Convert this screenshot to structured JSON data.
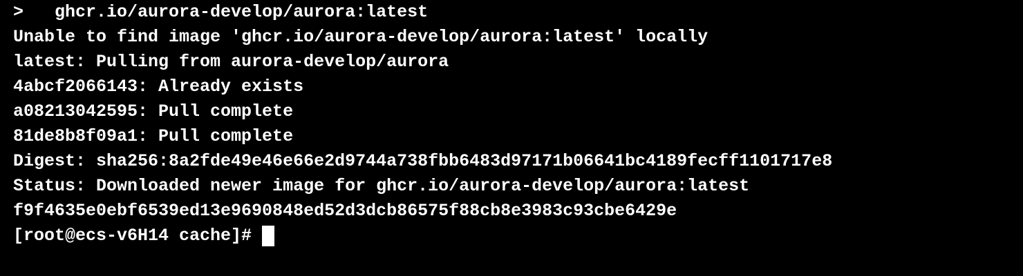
{
  "terminal": {
    "lines": [
      ">   ghcr.io/aurora-develop/aurora:latest",
      "Unable to find image 'ghcr.io/aurora-develop/aurora:latest' locally",
      "latest: Pulling from aurora-develop/aurora",
      "4abcf2066143: Already exists",
      "a08213042595: Pull complete",
      "81de8b8f09a1: Pull complete",
      "Digest: sha256:8a2fde49e46e66e2d9744a738fbb6483d97171b06641bc4189fecff1101717e8",
      "Status: Downloaded newer image for ghcr.io/aurora-develop/aurora:latest",
      "f9f4635e0ebf6539ed13e9690848ed52d3dcb86575f88cb8e3983c93cbe6429e"
    ],
    "prompt": "[root@ecs-v6H14 cache]#",
    "background_color": "#000000",
    "text_color": "#ffffff"
  }
}
